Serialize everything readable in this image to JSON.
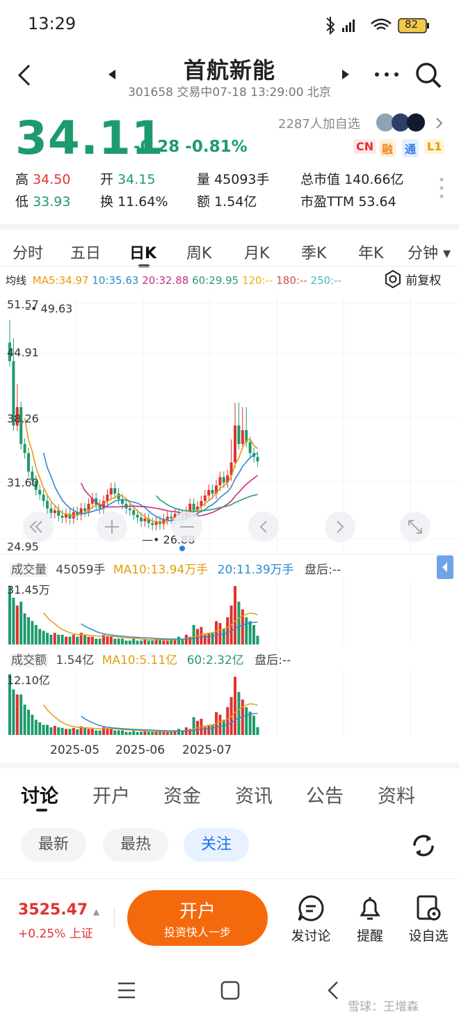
{
  "status_bar": {
    "time": "13:29",
    "battery": "82"
  },
  "header": {
    "title": "首航新能",
    "subtitle": "301658 交易中07-18 13:29:00 北京"
  },
  "quote": {
    "price": "34.11",
    "change": "-0.28 -0.81%",
    "followers": "2287人加自选",
    "badges": [
      "CN",
      "融",
      "通",
      "L1"
    ],
    "stats": {
      "high_label": "高",
      "high": "34.50",
      "open_label": "开",
      "open": "34.15",
      "volume_label": "量",
      "volume": "45093手",
      "mktcap_label": "总市值",
      "mktcap": "140.66亿",
      "low_label": "低",
      "low": "33.93",
      "turnover_label": "换",
      "turnover": "11.64%",
      "amount_label": "额",
      "amount": "1.54亿",
      "pe_label": "市盈TTM",
      "pe": "53.64"
    }
  },
  "kline_tabs": [
    "分时",
    "五日",
    "日K",
    "周K",
    "月K",
    "季K",
    "年K",
    "分钟"
  ],
  "ma_bar": {
    "label": "均线",
    "ma5": "MA5:34.97",
    "ma10": "10:35.63",
    "ma20": "20:32.88",
    "ma60": "60:29.95",
    "ma120": "120:--",
    "ma180": "180:--",
    "ma250": "250:--",
    "adjust": "前复权"
  },
  "price_axis": [
    "51.57",
    "44.91",
    "38.26",
    "31.60",
    "24.95"
  ],
  "price_marks": {
    "high": "49.63",
    "low": "26.88"
  },
  "volume_bar": {
    "label": "成交量",
    "value": "45059手",
    "ma10": "MA10:13.94万手",
    "ma20": "20:11.39万手",
    "after": "盘后:--",
    "axis_max": "31.45万"
  },
  "amount_bar": {
    "label": "成交额",
    "value": "1.54亿",
    "ma10": "MA10:5.11亿",
    "ma60": "60:2.32亿",
    "after": "盘后:--",
    "axis_max": "12.10亿"
  },
  "date_axis": [
    "2025-05",
    "2025-06",
    "2025-07"
  ],
  "discussion_tabs": [
    "讨论",
    "开户",
    "资金",
    "资讯",
    "公告",
    "资料"
  ],
  "filter_pills": [
    "最新",
    "最热",
    "关注"
  ],
  "bottom": {
    "index_value": "3525.47",
    "index_change": "+0.25% 上证",
    "open_account_label": "开户",
    "open_account_sub": "投资快人一步",
    "post_label": "发讨论",
    "alert_label": "提醒",
    "watch_label": "设自选"
  },
  "watermark": "雪球：王增森",
  "chart_data": [
    {
      "type": "candlestick",
      "ylim": [
        24.95,
        51.57
      ],
      "x_labels": [
        "2025-05",
        "2025-06",
        "2025-07"
      ],
      "close": [
        45,
        38,
        40,
        36,
        35,
        33,
        32,
        31,
        30.5,
        29.8,
        29,
        28.5,
        28.8,
        28.2,
        28.0,
        28.4,
        27.9,
        28.6,
        28.3,
        29.0,
        28.7,
        29.5,
        30.1,
        29.4,
        29.0,
        29.8,
        30.5,
        31.2,
        30.6,
        30.0,
        29.5,
        29.0,
        28.8,
        28.3,
        28.0,
        27.6,
        27.9,
        27.4,
        27.2,
        27.6,
        27.3,
        27.8,
        28.1,
        27.9,
        28.4,
        28.2,
        28.0,
        28.6,
        29.5,
        28.8,
        29.2,
        29.8,
        30.4,
        31.0,
        30.6,
        31.5,
        32.4,
        31.8,
        32.6,
        34.0,
        38.0,
        36.0,
        37.5,
        36.2,
        35.0,
        34.6,
        34.11
      ],
      "annotations": {
        "high": 49.63,
        "low": 26.88
      }
    },
    {
      "type": "bar",
      "name": "成交量",
      "ylim": [
        0,
        31.45
      ],
      "values": [
        30,
        24,
        20,
        22,
        16,
        14,
        12,
        10,
        8,
        7,
        6,
        5,
        6,
        5,
        5,
        4,
        4,
        5,
        4,
        6,
        5,
        4,
        4,
        3,
        3,
        5,
        4,
        4,
        3,
        3,
        3,
        2,
        2,
        3,
        2,
        2,
        3,
        2,
        2,
        3,
        3,
        2,
        2,
        3,
        3,
        4,
        3,
        5,
        4,
        10,
        8,
        9,
        5,
        6,
        6,
        12,
        11,
        8,
        14,
        20,
        30,
        22,
        18,
        14,
        12,
        10,
        4.5
      ]
    },
    {
      "type": "bar",
      "name": "成交额",
      "ylim": [
        0,
        12.1
      ],
      "values": [
        12,
        9,
        8,
        8,
        6,
        5,
        4,
        3,
        2.5,
        2,
        2,
        1.5,
        1.8,
        1.5,
        1.4,
        1.2,
        1.2,
        1.4,
        1.1,
        1.7,
        1.4,
        1.2,
        1.2,
        0.9,
        0.9,
        1.5,
        1.2,
        1.2,
        0.9,
        0.9,
        0.9,
        0.6,
        0.6,
        0.8,
        0.6,
        0.6,
        0.8,
        0.6,
        0.6,
        0.8,
        0.8,
        0.6,
        0.6,
        0.8,
        0.9,
        1.2,
        0.9,
        1.5,
        1.2,
        3.5,
        2.8,
        3.2,
        1.6,
        2,
        2,
        4.5,
        4,
        3,
        5.5,
        7.5,
        11.5,
        8.5,
        7,
        5.5,
        4.6,
        3.8,
        1.54
      ]
    }
  ]
}
